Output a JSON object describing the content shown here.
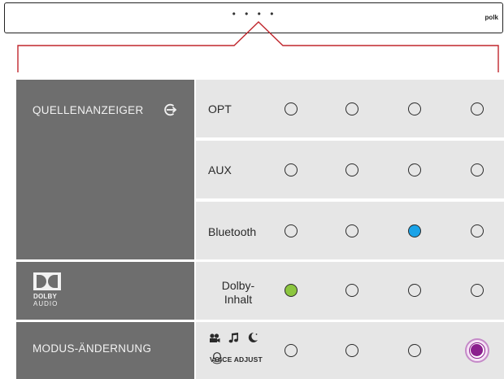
{
  "soundbar": {
    "led_indicator": "• • • •",
    "brand": "polk"
  },
  "source_indicator": {
    "label": "QUELLENANZEIGER",
    "icon": "input-arrow-icon",
    "rows": [
      {
        "label": "OPT",
        "leds": [
          "off",
          "off",
          "off",
          "off"
        ]
      },
      {
        "label": "AUX",
        "leds": [
          "off",
          "off",
          "off",
          "off"
        ]
      },
      {
        "label": "Bluetooth",
        "leds": [
          "off",
          "off",
          "blue",
          "off"
        ]
      }
    ]
  },
  "dolby": {
    "logo_text": "DOLBY",
    "logo_subtext": "AUDIO",
    "row_label_line1": "Dolby-",
    "row_label_line2": "Inhalt",
    "leds": [
      "green",
      "off",
      "off",
      "off"
    ]
  },
  "mode_change": {
    "label": "MODUS-ÄNDERNUNG",
    "icons": [
      "movie-camera-icon",
      "music-note-icon",
      "moon-icon"
    ],
    "voice_adjust_text": "VOICE ADJUST",
    "leds": [
      "off",
      "off",
      "off",
      "purple-pulsing"
    ]
  },
  "colors": {
    "left_panel": "#6e6e6e",
    "right_panel": "#e6e6e6",
    "pointer": "#c0272d",
    "blue": "#1aa3e8",
    "green": "#8cc63f",
    "purple": "#8b1f8e"
  }
}
